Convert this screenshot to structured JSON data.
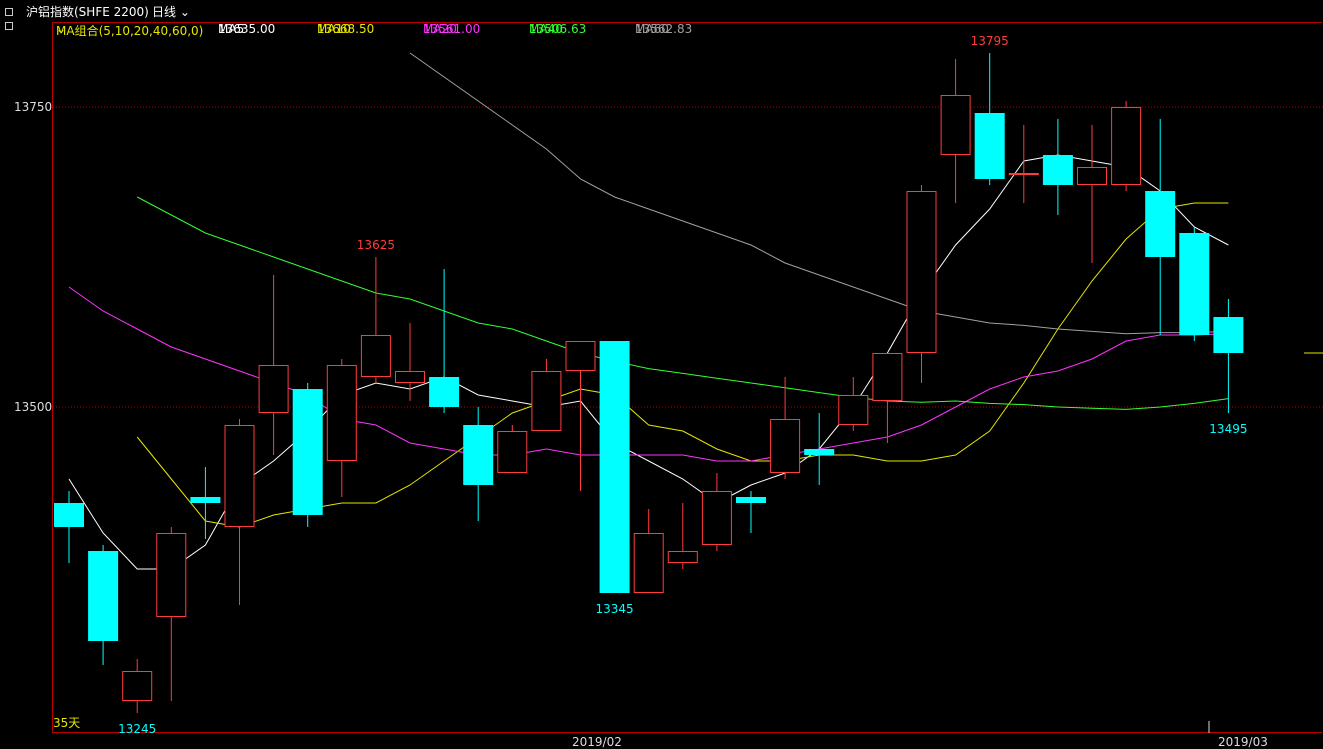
{
  "topbar": {
    "title": "沪铝指数(SHFE 2200)",
    "period": "日线"
  },
  "legend": {
    "group": "MA组合(5,10,20,40,60,0)",
    "items": [
      {
        "label": "MA5",
        "value": "13635.00",
        "color": "#ffffff"
      },
      {
        "label": "MA10",
        "value": "13668.50",
        "color": "#e6e600"
      },
      {
        "label": "MA20",
        "value": "13561.00",
        "color": "#ff33ff"
      },
      {
        "label": "MA40",
        "value": "13506.63",
        "color": "#33ff33"
      },
      {
        "label": "MA60",
        "value": "13562.83",
        "color": "#a0a0a0"
      }
    ]
  },
  "bottom": {
    "days": "35天"
  },
  "chart_data": {
    "type": "candlestick",
    "y_axis": {
      "ticks": [
        "13750",
        "13500"
      ],
      "range": [
        13220,
        13830
      ]
    },
    "x_axis": {
      "ticks": [
        "2019/02",
        "2019/03"
      ]
    },
    "colors": {
      "up": "#ff3c3c",
      "down": "#00ffff",
      "grid": "#b00000"
    },
    "candles": [
      {
        "o": 13420,
        "c": 13400,
        "h": 13430,
        "l": 13370
      },
      {
        "o": 13380,
        "c": 13305,
        "h": 13385,
        "l": 13285
      },
      {
        "o": 13255,
        "c": 13280,
        "h": 13290,
        "l": 13245
      },
      {
        "o": 13325,
        "c": 13395,
        "h": 13400,
        "l": 13255
      },
      {
        "o": 13425,
        "c": 13420,
        "h": 13450,
        "l": 13390
      },
      {
        "o": 13400,
        "c": 13485,
        "h": 13490,
        "l": 13335
      },
      {
        "o": 13495,
        "c": 13535,
        "h": 13610,
        "l": 13460
      },
      {
        "o": 13515,
        "c": 13410,
        "h": 13520,
        "l": 13400
      },
      {
        "o": 13455,
        "c": 13535,
        "h": 13540,
        "l": 13425
      },
      {
        "o": 13525,
        "c": 13560,
        "h": 13625,
        "l": 13520
      },
      {
        "o": 13520,
        "c": 13530,
        "h": 13570,
        "l": 13505
      },
      {
        "o": 13525,
        "c": 13500,
        "h": 13615,
        "l": 13495
      },
      {
        "o": 13485,
        "c": 13435,
        "h": 13500,
        "l": 13405
      },
      {
        "o": 13445,
        "c": 13480,
        "h": 13485,
        "l": 13445
      },
      {
        "o": 13480,
        "c": 13530,
        "h": 13540,
        "l": 13480
      },
      {
        "o": 13530,
        "c": 13555,
        "h": 13555,
        "l": 13430
      },
      {
        "o": 13555,
        "c": 13345,
        "h": 13555,
        "l": 13345
      },
      {
        "o": 13345,
        "c": 13395,
        "h": 13415,
        "l": 13345
      },
      {
        "o": 13370,
        "c": 13380,
        "h": 13420,
        "l": 13365
      },
      {
        "o": 13385,
        "c": 13430,
        "h": 13445,
        "l": 13380
      },
      {
        "o": 13425,
        "c": 13420,
        "h": 13430,
        "l": 13395
      },
      {
        "o": 13445,
        "c": 13490,
        "h": 13525,
        "l": 13440
      },
      {
        "o": 13465,
        "c": 13460,
        "h": 13495,
        "l": 13435
      },
      {
        "o": 13485,
        "c": 13510,
        "h": 13525,
        "l": 13480
      },
      {
        "o": 13505,
        "c": 13545,
        "h": 13545,
        "l": 13470
      },
      {
        "o": 13545,
        "c": 13680,
        "h": 13685,
        "l": 13520
      },
      {
        "o": 13710,
        "c": 13760,
        "h": 13790,
        "l": 13670
      },
      {
        "o": 13745,
        "c": 13690,
        "h": 13795,
        "l": 13685
      },
      {
        "o": 13695,
        "c": 13695,
        "h": 13735,
        "l": 13670
      },
      {
        "o": 13710,
        "c": 13685,
        "h": 13740,
        "l": 13660
      },
      {
        "o": 13685,
        "c": 13700,
        "h": 13735,
        "l": 13620
      },
      {
        "o": 13685,
        "c": 13750,
        "h": 13755,
        "l": 13680
      },
      {
        "o": 13680,
        "c": 13625,
        "h": 13740,
        "l": 13560
      },
      {
        "o": 13645,
        "c": 13560,
        "h": 13650,
        "l": 13555
      },
      {
        "o": 13575,
        "c": 13545,
        "h": 13590,
        "l": 13495
      }
    ],
    "ma": {
      "MA5": [
        13440,
        13395,
        13365,
        13365,
        13385,
        13435,
        13455,
        13480,
        13510,
        13520,
        13515,
        13525,
        13510,
        13505,
        13500,
        13505,
        13470,
        13455,
        13440,
        13420,
        13435,
        13445,
        13465,
        13500,
        13545,
        13595,
        13635,
        13665,
        13705,
        13710,
        13705,
        13700,
        13680,
        13650,
        13635
      ],
      "MA10": [
        13475,
        13440,
        13405,
        13400,
        13410,
        13415,
        13420,
        13420,
        13435,
        13455,
        13475,
        13495,
        13505,
        13515,
        13510,
        13485,
        13480,
        13465,
        13455,
        13455,
        13460,
        13460,
        13455,
        13455,
        13460,
        13480,
        13520,
        13565,
        13605,
        13640,
        13665,
        13670,
        13670
      ],
      "MA20": [
        13600,
        13580,
        13565,
        13550,
        13540,
        13530,
        13520,
        13510,
        13490,
        13485,
        13470,
        13465,
        13460,
        13460,
        13465,
        13460,
        13460,
        13460,
        13460,
        13455,
        13455,
        13460,
        13465,
        13470,
        13475,
        13485,
        13500,
        13515,
        13525,
        13530,
        13540,
        13555,
        13560,
        13560,
        13561
      ],
      "MA40": [
        13675,
        13660,
        13645,
        13635,
        13625,
        13615,
        13605,
        13595,
        13590,
        13580,
        13570,
        13565,
        13555,
        13545,
        13538,
        13532,
        13528,
        13524,
        13520,
        13516,
        13512,
        13508,
        13505,
        13504,
        13505,
        13503,
        13502,
        13500,
        13499,
        13498,
        13500,
        13503,
        13507
      ],
      "MA60": [
        13795,
        13775,
        13755,
        13735,
        13715,
        13690,
        13675,
        13665,
        13655,
        13645,
        13635,
        13620,
        13610,
        13600,
        13590,
        13580,
        13575,
        13570,
        13568,
        13565,
        13563,
        13561,
        13562,
        13562,
        13563
      ]
    },
    "annotations": [
      {
        "text": "13795",
        "type": "high",
        "index": 27,
        "color": "#ff3c3c"
      },
      {
        "text": "13625",
        "type": "high",
        "index": 9,
        "color": "#ff3c3c"
      },
      {
        "text": "13345",
        "type": "low",
        "index": 16,
        "color": "#00ffff"
      },
      {
        "text": "13495",
        "type": "low",
        "index": 34,
        "color": "#00ffff"
      },
      {
        "text": "13245",
        "type": "low",
        "index": 2,
        "color": "#00ffff"
      }
    ]
  }
}
